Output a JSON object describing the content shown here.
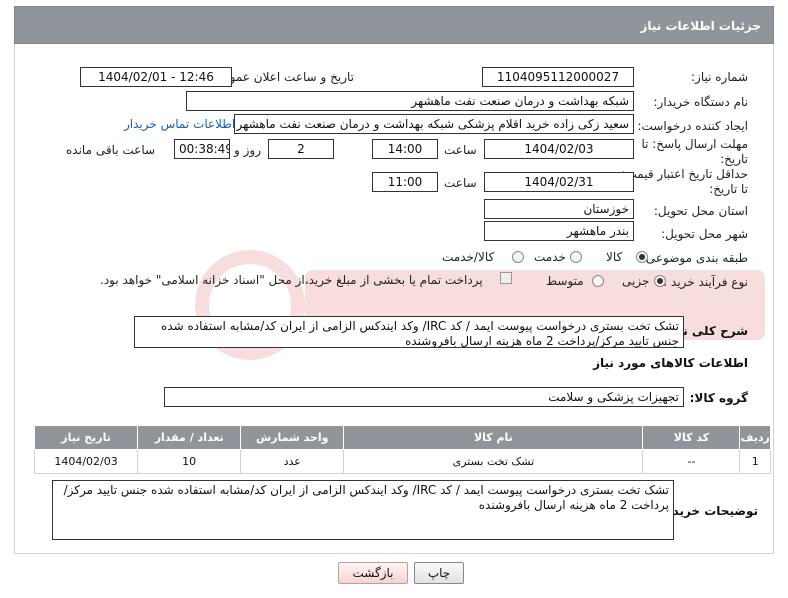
{
  "header": {
    "title": "جزئیات اطلاعات نیاز"
  },
  "form": {
    "need_number_label": "شماره نیاز:",
    "need_number": "1104095112000027",
    "announce_label": "تاریخ و ساعت اعلان عمومی:",
    "announce_value": "1404/02/01 - 12:46",
    "buyer_org_label": "نام دستگاه خریدار:",
    "buyer_org": "شبکه بهداشت و درمان صنعت نفت ماهشهر",
    "creator_label": "ایجاد کننده درخواست:",
    "creator": "سعید زکی زاده خرید اقلام پزشکی شبکه بهداشت و درمان صنعت نفت ماهشهر",
    "contact_link": "اطلاعات تماس خریدار",
    "reply_deadline_label": "مهلت ارسال پاسخ: تا تاریخ:",
    "reply_date": "1404/02/03",
    "time_label": "ساعت",
    "reply_time": "14:00",
    "days_value": "2",
    "days_label": "روز و",
    "remaining_time": "00:38:49",
    "remaining_label": "ساعت باقی مانده",
    "price_validity_label": "حداقل تاریخ اعتبار قیمت: تا تاریخ:",
    "price_date": "1404/02/31",
    "price_time": "11:00",
    "province_label": "استان محل تحویل:",
    "province": "خوزستان",
    "city_label": "شهر محل تحویل:",
    "city": "بندر ماهشهر",
    "category_label": "طبقه بندی موضوعی:",
    "category_options": [
      "کالا",
      "خدمت",
      "کالا/خدمت"
    ],
    "process_label": "نوع فرآیند خرید :",
    "process_options": [
      "جزیی",
      "متوسط"
    ],
    "payment_note": "پرداخت تمام یا بخشی از مبلغ خرید،از محل \"اسناد خزانه اسلامی\" خواهد بود."
  },
  "description": {
    "label": "شرح کلی نیاز:",
    "text": "تشک تخت بستری درخواست پیوست ایمد / کد IRC/ وکد ایندکس الزامی از ایران کد/مشابه استفاده شده جنس تایید مرکز/پرداخت 2 ماه هزینه ارسال بافروشنده"
  },
  "goods": {
    "section_title": "اطلاعات کالاهای مورد نیاز",
    "group_label": "گروه کالا:",
    "group_value": "تجهیزات پزشکی و سلامت",
    "columns": [
      "ردیف",
      "کد کالا",
      "نام کالا",
      "واحد شمارش",
      "تعداد / مقدار",
      "تاریخ نیاز"
    ],
    "rows": [
      {
        "row": "1",
        "code": "--",
        "name": "تشک تخت بستری",
        "unit": "عدد",
        "qty": "10",
        "date": "1404/02/03"
      }
    ]
  },
  "buyer_notes": {
    "label": "توضیحات خریدار:",
    "text": "تشک تخت بستری درخواست پیوست ایمد / کد IRC/ وکد ایندکس الزامی از ایران کد/مشابه استفاده شده جنس تایید مرکز/پرداخت 2 ماه هزینه ارسال بافروشنده"
  },
  "buttons": {
    "print": "چاپ",
    "back": "بازگشت"
  }
}
